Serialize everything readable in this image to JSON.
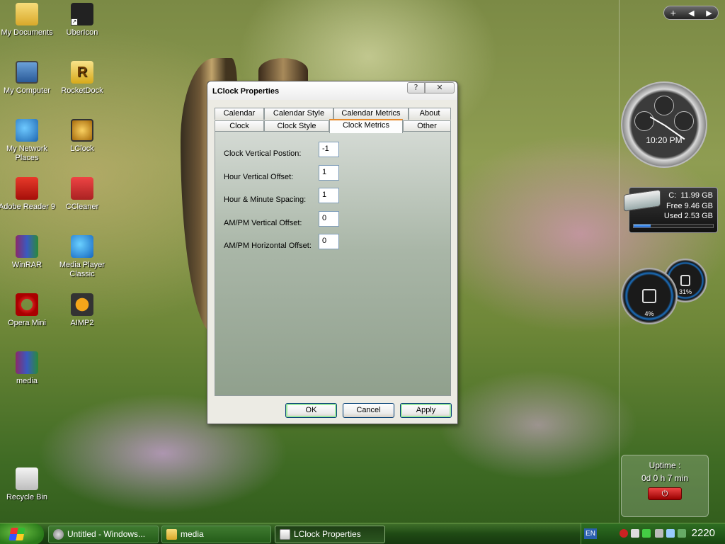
{
  "desktop": {
    "icons": [
      {
        "label": "My Documents",
        "icon": "folder-icon"
      },
      {
        "label": "UberIcon",
        "icon": "ubericon-icon"
      },
      {
        "label": "My Computer",
        "icon": "computer-icon"
      },
      {
        "label": "RocketDock",
        "icon": "rocketdock-icon",
        "glyph": "R"
      },
      {
        "label": "My Network Places",
        "icon": "network-icon"
      },
      {
        "label": "LClock",
        "icon": "lclock-icon"
      },
      {
        "label": "Adobe Reader 9",
        "icon": "adobe-reader-icon"
      },
      {
        "label": "CCleaner",
        "icon": "ccleaner-icon"
      },
      {
        "label": "WinRAR",
        "icon": "winrar-icon"
      },
      {
        "label": "Media Player Classic",
        "icon": "media-player-icon"
      },
      {
        "label": "Opera Mini",
        "icon": "opera-icon"
      },
      {
        "label": "AIMP2",
        "icon": "aimp-icon"
      },
      {
        "label": "media",
        "icon": "rar-archive-icon"
      },
      {
        "label": "Recycle Bin",
        "icon": "recycle-bin-icon"
      }
    ]
  },
  "dialog": {
    "title": "LClock Properties",
    "help_glyph": "?",
    "close_glyph": "✕",
    "tabs_row1": [
      "Calendar",
      "Calendar Style",
      "Calendar Metrics",
      "About"
    ],
    "tabs_row2": [
      "Clock",
      "Clock Style",
      "Clock Metrics",
      "Other"
    ],
    "active_tab": "Clock Metrics",
    "fields": [
      {
        "label": "Clock Vertical Postion:",
        "value": "-1"
      },
      {
        "label": "Hour Vertical Offset:",
        "value": "1"
      },
      {
        "label": "Hour & Minute Spacing:",
        "value": "1"
      },
      {
        "label": "AM/PM Vertical Offset:",
        "value": "0"
      },
      {
        "label": "AM/PM Horizontal Offset:",
        "value": "0"
      }
    ],
    "buttons": {
      "ok": "OK",
      "cancel": "Cancel",
      "apply": "Apply"
    }
  },
  "gadgets": {
    "toolbar": {
      "add": "+",
      "prev": "◀",
      "next": "▶"
    },
    "clock": {
      "time": "10:20 PM"
    },
    "drive": {
      "drive": "C:",
      "capacity": "11.99 GB",
      "free_label": "Free",
      "free": "9.46 GB",
      "used_label": "Used",
      "used": "2.53 GB",
      "used_fraction": 0.21
    },
    "cpu_meter": {
      "value": "4%"
    },
    "mem_meter": {
      "value": "31%"
    },
    "uptime": {
      "title": "Uptime :",
      "value": "0d 0 h 7 min",
      "power_glyph": "⏻"
    }
  },
  "taskbar": {
    "tasks": [
      {
        "label": "Untitled - Windows...",
        "icon": "windows-movie-maker-icon"
      },
      {
        "label": "media",
        "icon": "folder-icon"
      },
      {
        "label": "LClock Properties",
        "icon": "window-icon",
        "active": true
      }
    ],
    "tray": {
      "language": "EN",
      "clock": "2220"
    }
  }
}
